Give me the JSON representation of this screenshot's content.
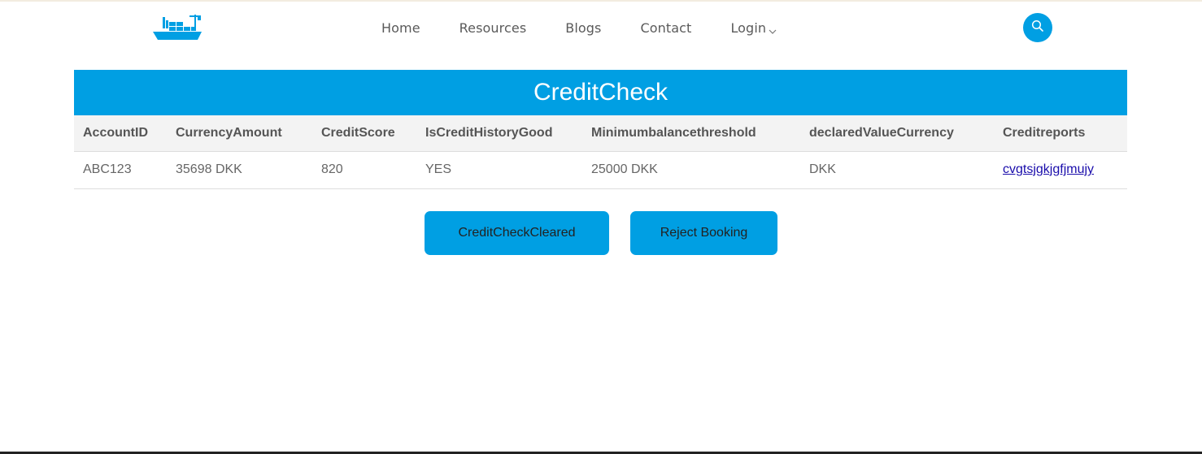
{
  "nav": {
    "links": [
      "Home",
      "Resources",
      "Blogs",
      "Contact"
    ],
    "login_label": "Login"
  },
  "icons": {
    "logo": "ship-logo-icon",
    "search": "search-icon",
    "dropdown": "chevron-down-icon"
  },
  "colors": {
    "accent": "#009fe3",
    "link": "#1a0dab"
  },
  "panel": {
    "title": "CreditCheck",
    "columns": [
      "AccountID",
      "CurrencyAmount",
      "CreditScore",
      "IsCreditHistoryGood",
      "Minimumbalancethreshold",
      "declaredValueCurrency",
      "Creditreports"
    ],
    "rows": [
      [
        "ABC123",
        "35698 DKK",
        "820",
        "YES",
        "25000 DKK",
        "DKK",
        "cvgtsjgkjgfjmujy"
      ]
    ]
  },
  "actions": {
    "cleared_label": "CreditCheckCleared",
    "reject_label": "Reject Booking"
  }
}
